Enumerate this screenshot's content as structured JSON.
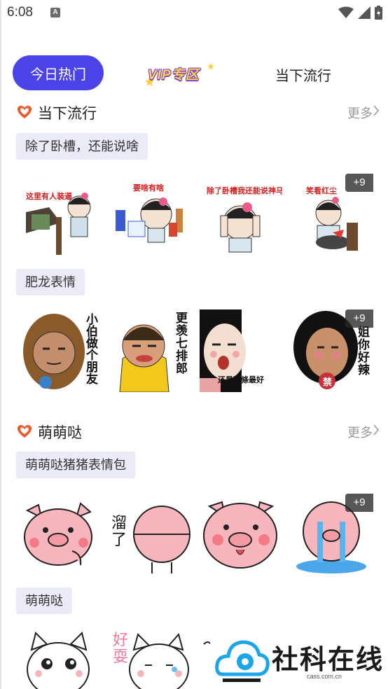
{
  "status": {
    "time": "6:08"
  },
  "tabs": {
    "today": "今日热门",
    "vip": "VIP专区",
    "trending": "当下流行"
  },
  "sections": [
    {
      "title": "当下流行",
      "more": "更多"
    },
    {
      "title": "萌萌哒",
      "more": "更多"
    }
  ],
  "groups": [
    {
      "name": "除了卧槽，还能说啥",
      "badge": "+9",
      "captions": [
        "这里有人装逼",
        "要啥有啥",
        "除了卧槽我还能说神马",
        "笑看红尘"
      ]
    },
    {
      "name": "肥龙表情",
      "badge": "+9",
      "captions": [
        "小伯做个朋友",
        "更羡七排郎",
        "还是著條最好",
        "姐你好辣"
      ],
      "tag": "禁"
    },
    {
      "name": "萌萌哒猪猪表情包",
      "badge": "+9",
      "captions": [
        "溜了"
      ]
    },
    {
      "name": "萌萌哒",
      "captions": [
        "好耍"
      ]
    }
  ],
  "watermark": {
    "brand": "社科在线",
    "url": "cass.com.cn"
  },
  "colors": {
    "accent": "#4b43e8",
    "heart": "#f05a2a",
    "chip_bg": "#ebebf7"
  }
}
